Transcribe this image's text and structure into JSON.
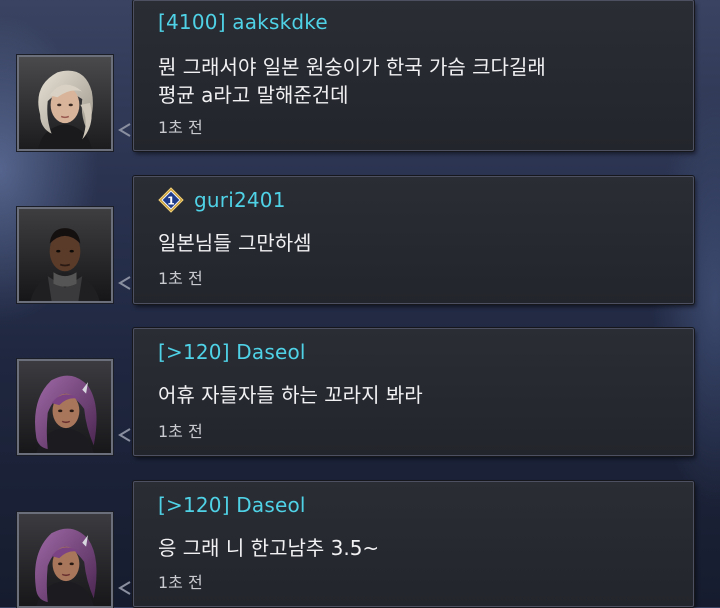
{
  "messages": [
    {
      "username": "[4100] aakskdke",
      "text_lines": [
        "뭔 그래서야 일본 원숭이가 한국 가슴 크다길래",
        "평균 a라고 말해준건데"
      ],
      "time": "1초 전",
      "avatar": "female-silver-hair-avatar",
      "has_rank_icon": false
    },
    {
      "username": "guri2401",
      "text_lines": [
        "일본님들 그만하셈"
      ],
      "time": "1초 전",
      "avatar": "male-dark-skin-avatar",
      "has_rank_icon": true,
      "rank_icon": "rank-1-diamond-icon",
      "rank_number": "1"
    },
    {
      "username": "[>120] Daseol",
      "text_lines": [
        "어휴 자들자들 하는 꼬라지 봐라"
      ],
      "time": "1초 전",
      "avatar": "female-purple-hair-avatar",
      "has_rank_icon": false
    },
    {
      "username": "[>120] Daseol",
      "text_lines": [
        "응 그래 니 한고남추 3.5~"
      ],
      "time": "1초 전",
      "avatar": "female-purple-hair-avatar",
      "has_rank_icon": false
    }
  ],
  "colors": {
    "username": "#4fd2e6",
    "message_text": "#f1f1f3",
    "timestamp": "#c8cad0",
    "bubble_bg": "#2b2d35",
    "background": "#1f2740"
  }
}
